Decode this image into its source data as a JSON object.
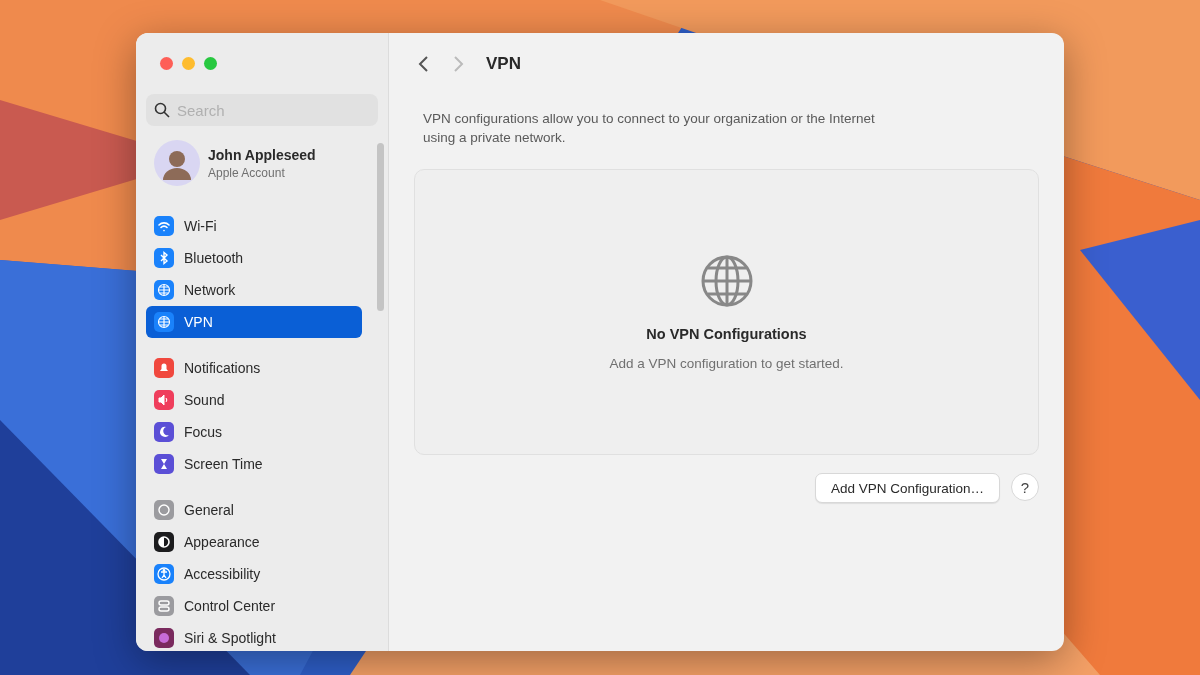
{
  "window": {
    "title": "VPN"
  },
  "sidebar": {
    "search": {
      "placeholder": "Search"
    },
    "account": {
      "name": "John Appleseed",
      "subtitle": "Apple Account"
    },
    "groups": [
      {
        "items": [
          {
            "label": "Wi-Fi",
            "selected": false,
            "color": "#1a82fb"
          },
          {
            "label": "Bluetooth",
            "selected": false,
            "color": "#1a82fb"
          },
          {
            "label": "Network",
            "selected": false,
            "color": "#1a82fb"
          },
          {
            "label": "VPN",
            "selected": true,
            "color": "#1a82fb"
          }
        ]
      },
      {
        "items": [
          {
            "label": "Notifications",
            "selected": false,
            "color": "#f0483e"
          },
          {
            "label": "Sound",
            "selected": false,
            "color": "#ef3e5c"
          },
          {
            "label": "Focus",
            "selected": false,
            "color": "#5b4fd6"
          },
          {
            "label": "Screen Time",
            "selected": false,
            "color": "#5b4fd6"
          }
        ]
      },
      {
        "items": [
          {
            "label": "General",
            "selected": false,
            "color": "#9b9b9f"
          },
          {
            "label": "Appearance",
            "selected": false,
            "color": "#1c1c1e"
          },
          {
            "label": "Accessibility",
            "selected": false,
            "color": "#1a82fb"
          },
          {
            "label": "Control Center",
            "selected": false,
            "color": "#9b9b9f"
          },
          {
            "label": "Siri & Spotlight",
            "selected": false,
            "color": "#7a2a5e"
          }
        ]
      }
    ]
  },
  "content": {
    "description": "VPN configurations allow you to connect to your organization or the Internet using a private network.",
    "empty_title": "No VPN Configurations",
    "empty_subtitle": "Add a VPN configuration to get started.",
    "add_button": "Add VPN Configuration…",
    "help_button": "?"
  }
}
